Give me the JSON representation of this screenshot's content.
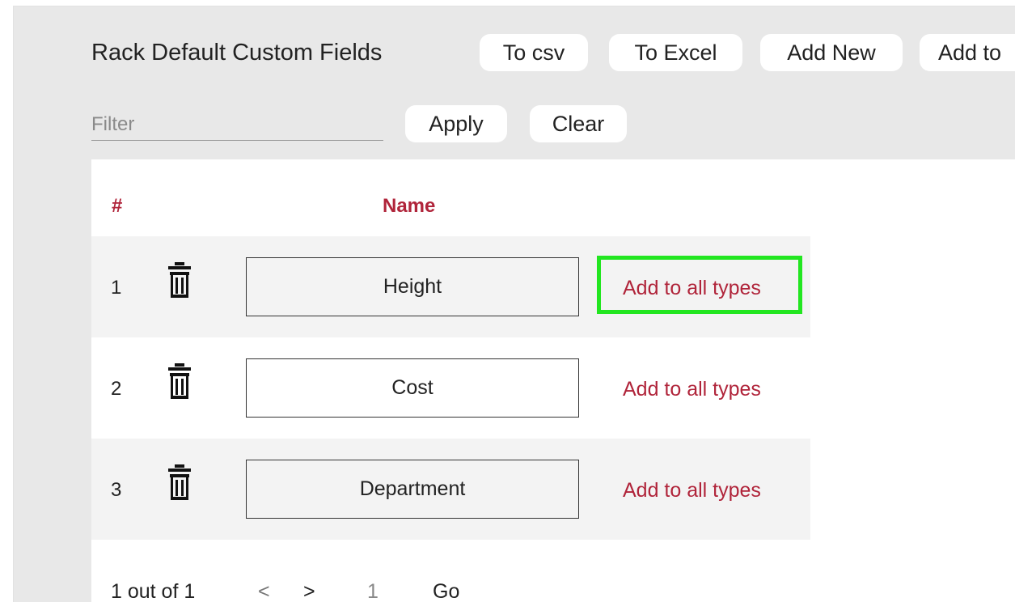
{
  "page": {
    "title": "Rack Default Custom Fields"
  },
  "toolbar": {
    "to_csv": "To csv",
    "to_excel": "To Excel",
    "add_new": "Add New",
    "add_to": "Add to"
  },
  "filter": {
    "placeholder": "Filter",
    "value": "",
    "apply": "Apply",
    "clear": "Clear"
  },
  "table": {
    "headers": {
      "num": "#",
      "name": "Name"
    },
    "rows": [
      {
        "num": "1",
        "name": "Height",
        "action": "Add to all types"
      },
      {
        "num": "2",
        "name": "Cost",
        "action": "Add to all types"
      },
      {
        "num": "3",
        "name": "Department",
        "action": "Add to all types"
      }
    ]
  },
  "pagination": {
    "info": "1 out of 1",
    "prev": "<",
    "next": ">",
    "page": "1",
    "go": "Go"
  },
  "colors": {
    "accent": "#b0243a",
    "highlight": "#22e620",
    "panel": "#e8e8e8",
    "row_alt": "#f3f3f3"
  },
  "icons": {
    "delete": "trash-icon"
  }
}
